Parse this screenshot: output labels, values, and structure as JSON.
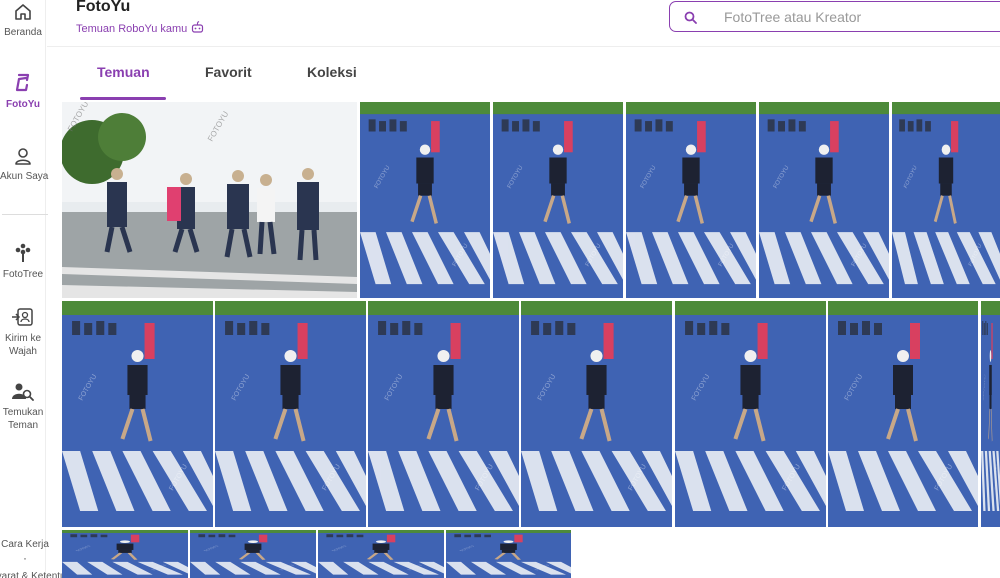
{
  "app": {
    "title": "FotoYu",
    "subtitle": "Temuan RoboYu kamu"
  },
  "sidebar": {
    "items": [
      {
        "label": "Beranda",
        "icon": "home-icon"
      },
      {
        "label": "FotoYu",
        "icon": "fotoyu-logo-icon",
        "active": true
      },
      {
        "label": "Akun Saya",
        "icon": "user-icon"
      },
      {
        "label": "FotoTree",
        "icon": "tree-icon"
      },
      {
        "label": "Kirim ke Wajah",
        "icon": "face-scan-icon"
      },
      {
        "label": "Temukan Teman",
        "icon": "find-friend-icon"
      }
    ],
    "footer_line1": "Cara Kerja",
    "footer_line2": "Syarat & Ketentuan"
  },
  "search": {
    "placeholder": "FotoTree atau Kreator",
    "value": ""
  },
  "tabs": [
    {
      "label": "Temuan",
      "active": true
    },
    {
      "label": "Favorit",
      "active": false
    },
    {
      "label": "Koleksi",
      "active": false
    }
  ],
  "colors": {
    "accent": "#8a3fb0",
    "road": "#3f63b3",
    "grass": "#4d8a3a"
  },
  "photos": {
    "count_visible": 17,
    "watermark": "FOTOYU"
  }
}
